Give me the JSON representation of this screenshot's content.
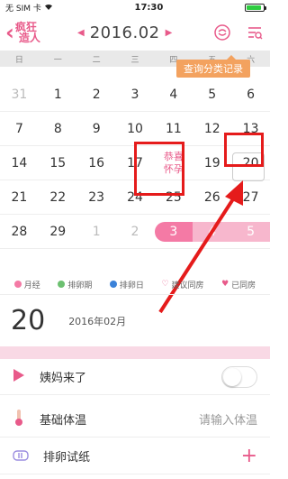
{
  "status_bar": {
    "carrier": "无 SIM 卡",
    "wifi_icon": "wifi-icon",
    "time": "17:30",
    "battery_level": 0.9
  },
  "nav": {
    "logo_line1": "疯狂",
    "logo_line2": "造人",
    "month": "2016.02",
    "icons": [
      "sync-icon",
      "query-list-icon"
    ]
  },
  "tooltip": "查询分类记录",
  "weekdays": [
    "日",
    "一",
    "二",
    "三",
    "四",
    "五",
    "六"
  ],
  "calendar": {
    "weeks": [
      [
        "31",
        "1",
        "2",
        "3",
        "4",
        "5",
        "6"
      ],
      [
        "7",
        "8",
        "9",
        "10",
        "11",
        "12",
        "13"
      ],
      [
        "14",
        "15",
        "16",
        "17",
        "",
        "19",
        "20"
      ],
      [
        "21",
        "22",
        "23",
        "24",
        "25",
        "26",
        "27"
      ],
      [
        "28",
        "29",
        "1",
        "2",
        "3",
        "4",
        "5"
      ]
    ],
    "congrats_line1": "恭喜",
    "congrats_line2": "怀孕"
  },
  "legend": [
    {
      "label": "月经",
      "color": "#f47aa5",
      "icon": "dot"
    },
    {
      "label": "排卵期",
      "color": "#6cc070",
      "icon": "dot"
    },
    {
      "label": "排卵日",
      "color": "#3b82d9",
      "icon": "dot"
    },
    {
      "label": "建议同房",
      "color": "#e85a8a",
      "icon": "heart-outline-icon"
    },
    {
      "label": "已同房",
      "color": "#e85a8a",
      "icon": "heart-filled-icon"
    }
  ],
  "selected_date": {
    "day": "20",
    "month_text": "2016年02月"
  },
  "rows": {
    "period_label": "姨妈来了",
    "temp_label": "基础体温",
    "temp_placeholder": "请输入体温",
    "ovulation_label": "排卵试纸"
  }
}
